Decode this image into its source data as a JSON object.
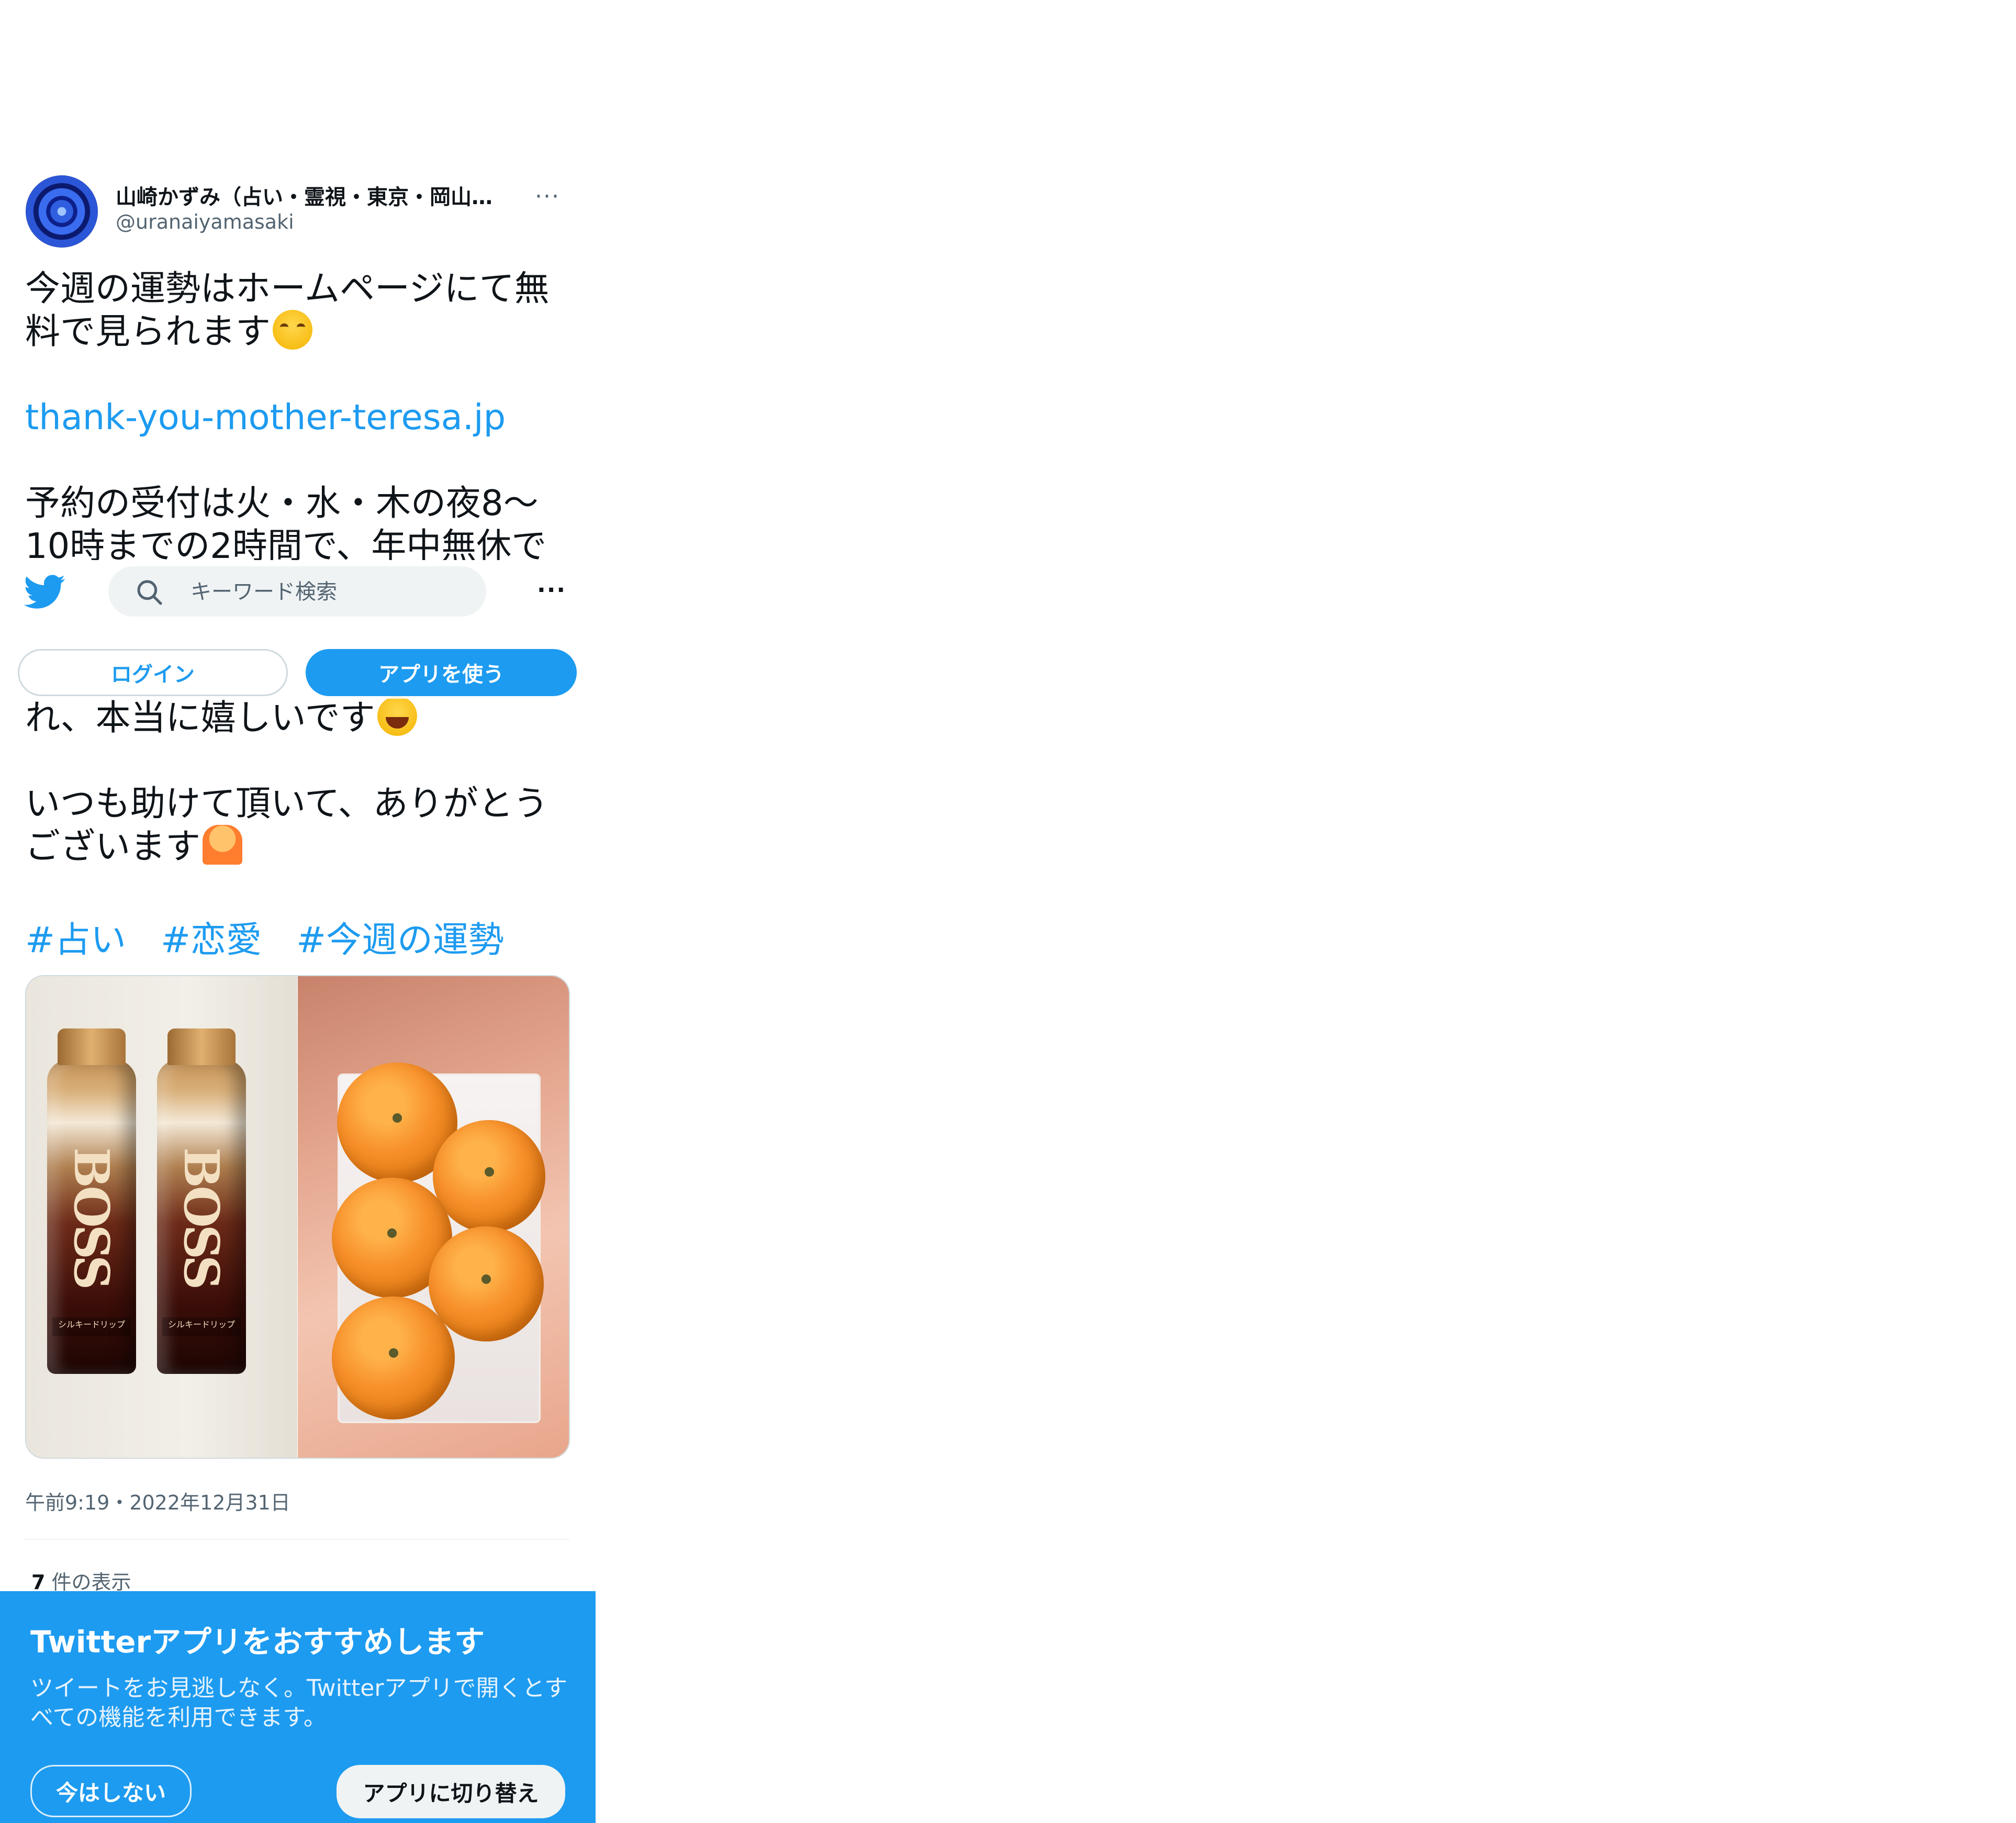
{
  "tweet": {
    "display_name": "山崎かずみ（占い・霊視・東京・岡山…",
    "handle": "@uranaiyamasaki",
    "more_label": "···",
    "body_lines": [
      "今週の運勢はホームページにて無料で見られます",
      "thank-you-mother-teresa.jp",
      "予約の受付は火・水・木の夜8〜",
      "10時までの2時間で、年中無休で"
    ],
    "body_lower_lines": [
      "れ、本当に嬉しいです",
      "いつも助けて頂いて、ありがとうございます"
    ],
    "hashtags": [
      "#占い",
      "#恋愛",
      "#今週の運勢"
    ],
    "media_labels": {
      "bottle_brand": "BOSS",
      "bottle_subtitle": "シルキードリップ"
    },
    "timestamp": "午前9:19・2022年12月31日",
    "views_count": "7",
    "views_label": "件の表示"
  },
  "icons": {
    "avatar": "avatar",
    "bird": "twitter-bird-icon",
    "search": "search-icon",
    "more": "more-icon"
  },
  "nav": {
    "search_placeholder": "キーワード検索",
    "more_label": "···",
    "login_label": "ログイン",
    "use_app_label": "アプリを使う"
  },
  "banner": {
    "title": "Twitterアプリをおすすめします",
    "description": "ツイートをお見逃しなく。Twitterアプリで開くとすべての機能を利用できます。",
    "not_now_label": "今はしない",
    "switch_label": "アプリに切り替え"
  },
  "colors": {
    "accent": "#1d9bf0",
    "text": "#0f1419",
    "muted": "#536471"
  }
}
